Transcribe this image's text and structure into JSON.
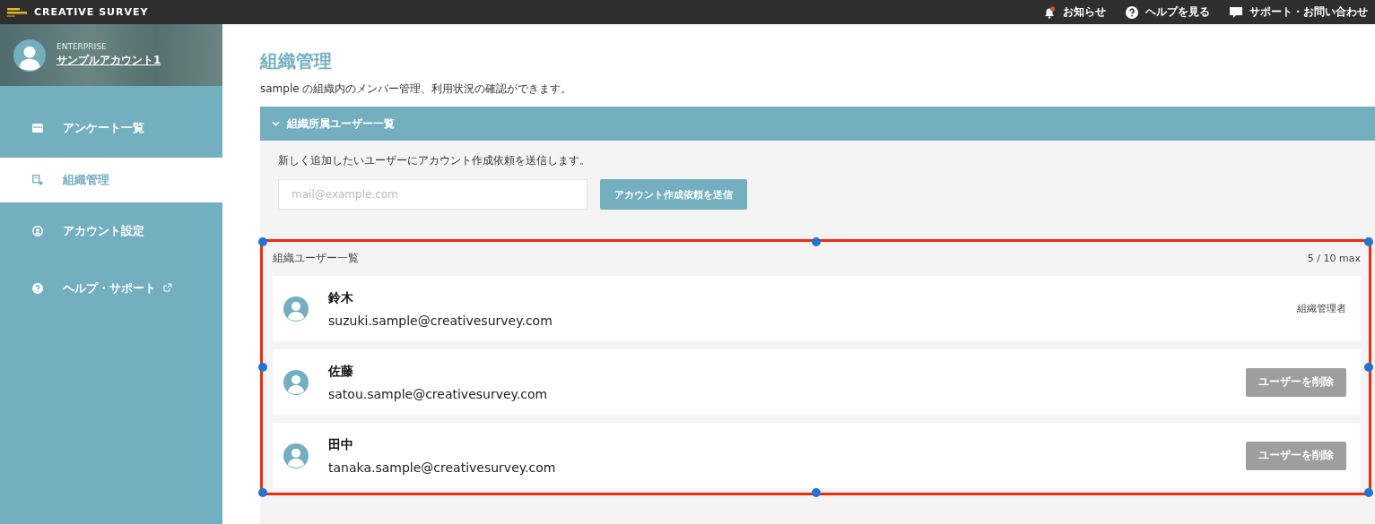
{
  "topbar": {
    "brand": "CREATIVE SURVEY",
    "links": [
      {
        "kind": "notice",
        "label": "お知らせ"
      },
      {
        "kind": "help",
        "label": "ヘルプを見る"
      },
      {
        "kind": "support",
        "label": "サポート・お問い合わせ"
      }
    ]
  },
  "account": {
    "plan": "ENTERPRISE",
    "name": "サンプルアカウント1"
  },
  "sidebar": {
    "items": [
      {
        "kind": "survey",
        "label": "アンケート一覧",
        "selected": false,
        "external": false
      },
      {
        "kind": "org",
        "label": "組織管理",
        "selected": true,
        "external": false
      },
      {
        "kind": "account",
        "label": "アカウント設定",
        "selected": false,
        "external": false
      },
      {
        "kind": "help",
        "label": "ヘルプ・サポート",
        "selected": false,
        "external": true
      }
    ]
  },
  "page": {
    "title": "組織管理",
    "description": "sample の組織内のメンバー管理、利用状況の確認ができます。"
  },
  "section": {
    "title": "組織所属ユーザー一覧",
    "expanded": true,
    "invite_text": "新しく追加したいユーザーにアカウント作成依頼を送信します。",
    "email_placeholder": "mail@example.com",
    "send_button": "アカウント作成依頼を送信"
  },
  "users": {
    "title": "組織ユーザー一覧",
    "count": "5 / 10 max",
    "rows": [
      {
        "name": "鈴木",
        "email": "suzuki.sample@creativesurvey.com",
        "kind": "admin",
        "action": "組織管理者"
      },
      {
        "name": "佐藤",
        "email": "satou.sample@creativesurvey.com",
        "kind": "member",
        "action": "ユーザーを削除"
      },
      {
        "name": "田中",
        "email": "tanaka.sample@creativesurvey.com",
        "kind": "member",
        "action": "ユーザーを削除"
      }
    ]
  }
}
